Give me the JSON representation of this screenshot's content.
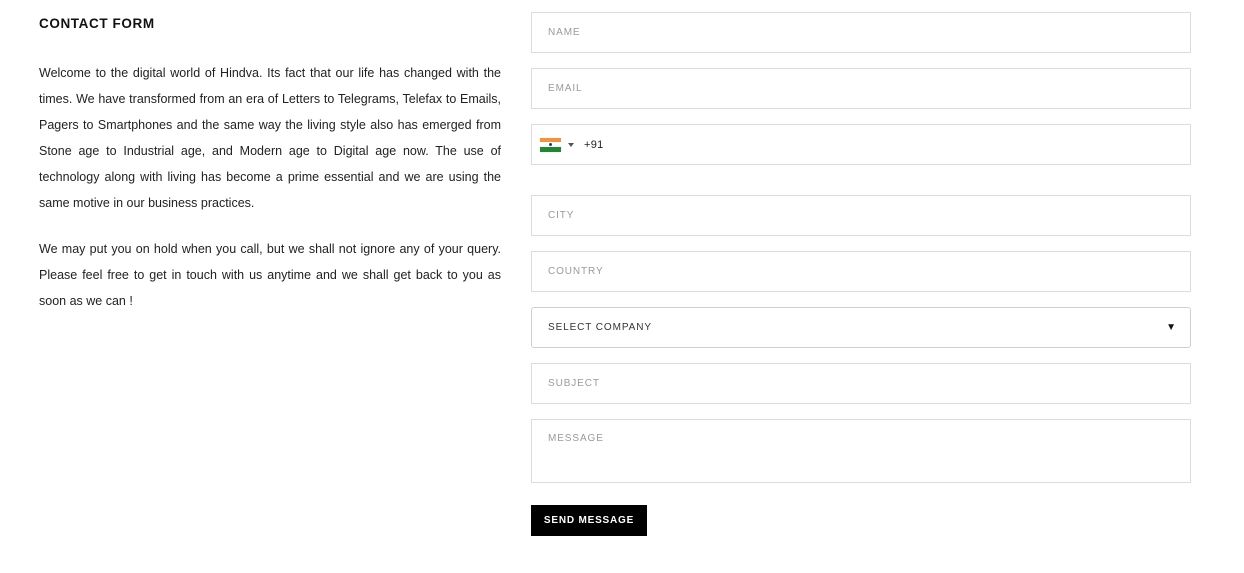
{
  "intro": {
    "title": "CONTACT FORM",
    "paragraphs": [
      "Welcome to the digital world of Hindva. Its fact that our life has changed with the times. We have transformed from an era of Letters to Telegrams, Telefax to Emails, Pagers to Smartphones and the same way the living style also has emerged from Stone age to Industrial age, and Modern age to Digital age now. The use of technology along with living has become a prime essential and we are using the same motive in our business practices.",
      "We may put you on hold when you call, but we shall not ignore any of your query. Please feel free to get in touch with us anytime and we shall get back to you as soon as we can !"
    ]
  },
  "form": {
    "name_placeholder": "NAME",
    "email_placeholder": "EMAIL",
    "phone": {
      "flag_icon": "india-flag-icon",
      "dial_code": "+91"
    },
    "city_placeholder": "CITY",
    "country_placeholder": "COUNTRY",
    "company_select": {
      "selected": "SELECT COMPANY",
      "arrow_icon": "triangle-down-icon"
    },
    "subject_placeholder": "SUBJECT",
    "message_placeholder": "MESSAGE",
    "submit_label": "SEND MESSAGE"
  },
  "colors": {
    "button_bg": "#000000",
    "border": "#dcdcdc",
    "flag_saffron": "#f7923a",
    "flag_green": "#1e8a2f"
  }
}
